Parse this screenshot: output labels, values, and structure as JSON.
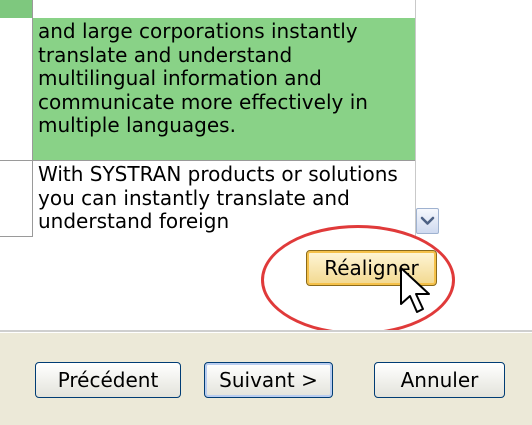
{
  "segments": {
    "highlighted_text": "and large corporations instantly translate and understand multilingual information and communicate more effectively in multiple languages.",
    "next_text": "With SYSTRAN products or solutions you can instantly translate and understand foreign"
  },
  "realign_button": {
    "label": "Réaligner"
  },
  "footer": {
    "previous_label": "Précédent",
    "next_label": "Suivant >",
    "cancel_label": "Annuler"
  },
  "colors": {
    "highlight": "#89d287",
    "annotation_circle": "#e03a3a"
  },
  "icons": [
    "chevron-down-icon",
    "mouse-pointer-icon"
  ]
}
